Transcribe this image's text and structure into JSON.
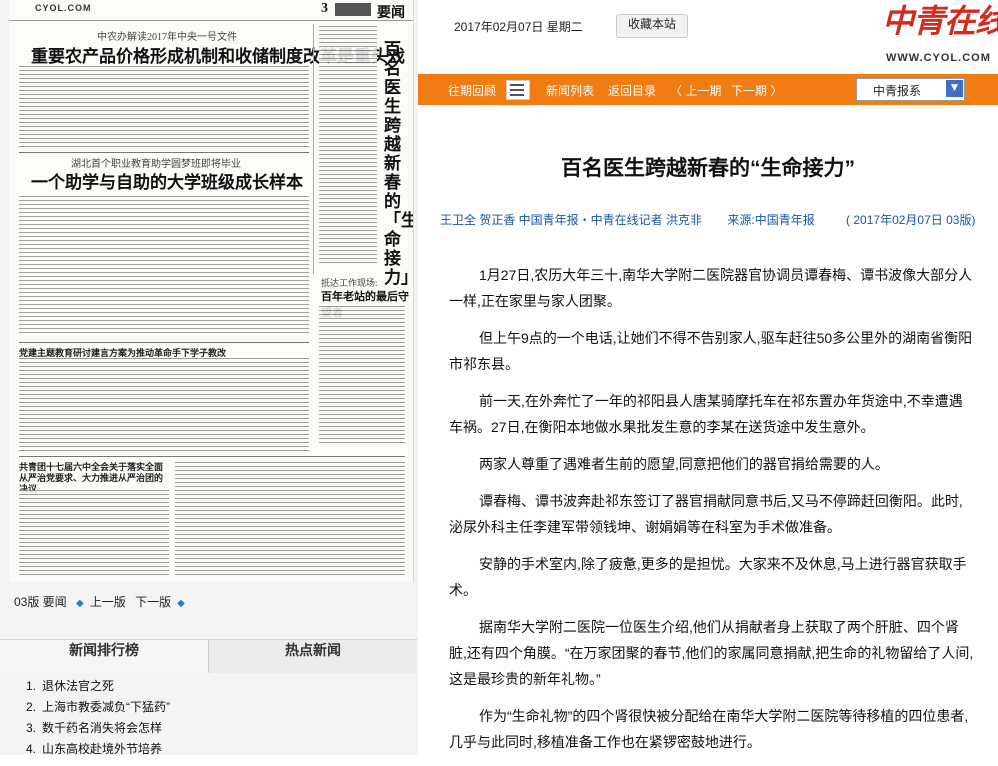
{
  "newspaper": {
    "site": "CYOL.COM",
    "page_number": "3",
    "section": "要闻",
    "subhead1": "中农办解读2017年中央一号文件",
    "headline1": "重要农产品价格形成机制和收储制度改革是重头戏",
    "subhead2": "湖北首个职业教育助学圆梦班即将毕业",
    "headline2": "一个助学与自助的大学班级成长样本",
    "vertical_headline": "百名医生跨越新春的「生命接力」",
    "box_sub": "抵达工作现场:",
    "box_headline": "百年老站的最后守望者",
    "headline3": "党建主题教育研讨建言方案为推动革命手下学子教改",
    "headline4": "共青团十七届六中全会关于落实全面从严治党要求、大力推进从严治团的决议"
  },
  "page_nav": {
    "current": "03版 要闻",
    "prev": "上一版",
    "next": "下一版"
  },
  "ranking": {
    "tab_rank": "新闻排行榜",
    "tab_hot": "热点新闻",
    "items": [
      {
        "n": "1.",
        "t": "退休法官之死"
      },
      {
        "n": "2.",
        "t": "上海市教委减负“下猛药”"
      },
      {
        "n": "3.",
        "t": "数千药名消失将会怎样"
      },
      {
        "n": "4.",
        "t": "山东高校赴境外节培养"
      }
    ]
  },
  "header": {
    "date": "2017年02月07日  星期二",
    "favorite": "收藏本站",
    "logo_text": "中青在线",
    "logo_url": "WWW.CYOL.COM"
  },
  "nav": {
    "past": "往期回顾",
    "list": "新闻列表",
    "back": "返回目录",
    "prev": "〈 上一期",
    "next": "下一期 〉",
    "select_value": "中青报系"
  },
  "article": {
    "title": "百名医生跨越新春的“生命接力”",
    "authors": "王卫全  贺正香  中国青年报・中青在线记者  洪克非",
    "source": "来源:中国青年报",
    "date": "(  2017年02月07日  03版)",
    "paragraphs": [
      "1月27日,农历大年三十,南华大学附二医院器官协调员谭春梅、谭书波像大部分人一样,正在家里与家人团聚。",
      "但上午9点的一个电话,让她们不得不告别家人,驱车赶往50多公里外的湖南省衡阳市祁东县。",
      "前一天,在外奔忙了一年的祁阳县人唐某骑摩托车在祁东置办年货途中,不幸遭遇车祸。27日,在衡阳本地做水果批发生意的李某在送货途中发生意外。",
      "两家人尊重了遇难者生前的愿望,同意把他们的器官捐给需要的人。",
      "谭春梅、谭书波奔赴祁东签订了器官捐献同意书后,又马不停蹄赶回衡阳。此时,泌尿外科主任李建军带领钱坤、谢娟娟等在科室为手术做准备。",
      "安静的手术室内,除了疲惫,更多的是担忧。大家来不及休息,马上进行器官获取手术。",
      "据南华大学附二医院一位医生介绍,他们从捐献者身上获取了两个肝脏、四个肾脏,还有四个角膜。“在万家团聚的春节,他们的家属同意捐献,把生命的礼物留给了人间,这是最珍贵的新年礼物。”",
      "作为“生命礼物”的四个肾很快被分配给在南华大学附二医院等待移植的四位患者,几乎与此同时,移植准备工作也在紧锣密鼓地进行。"
    ]
  },
  "colors": {
    "nav_bar": "#f07c12",
    "logo_red": "#d32b1e",
    "meta_blue": "#1a55a8",
    "select_button": "#3f6fc6"
  }
}
